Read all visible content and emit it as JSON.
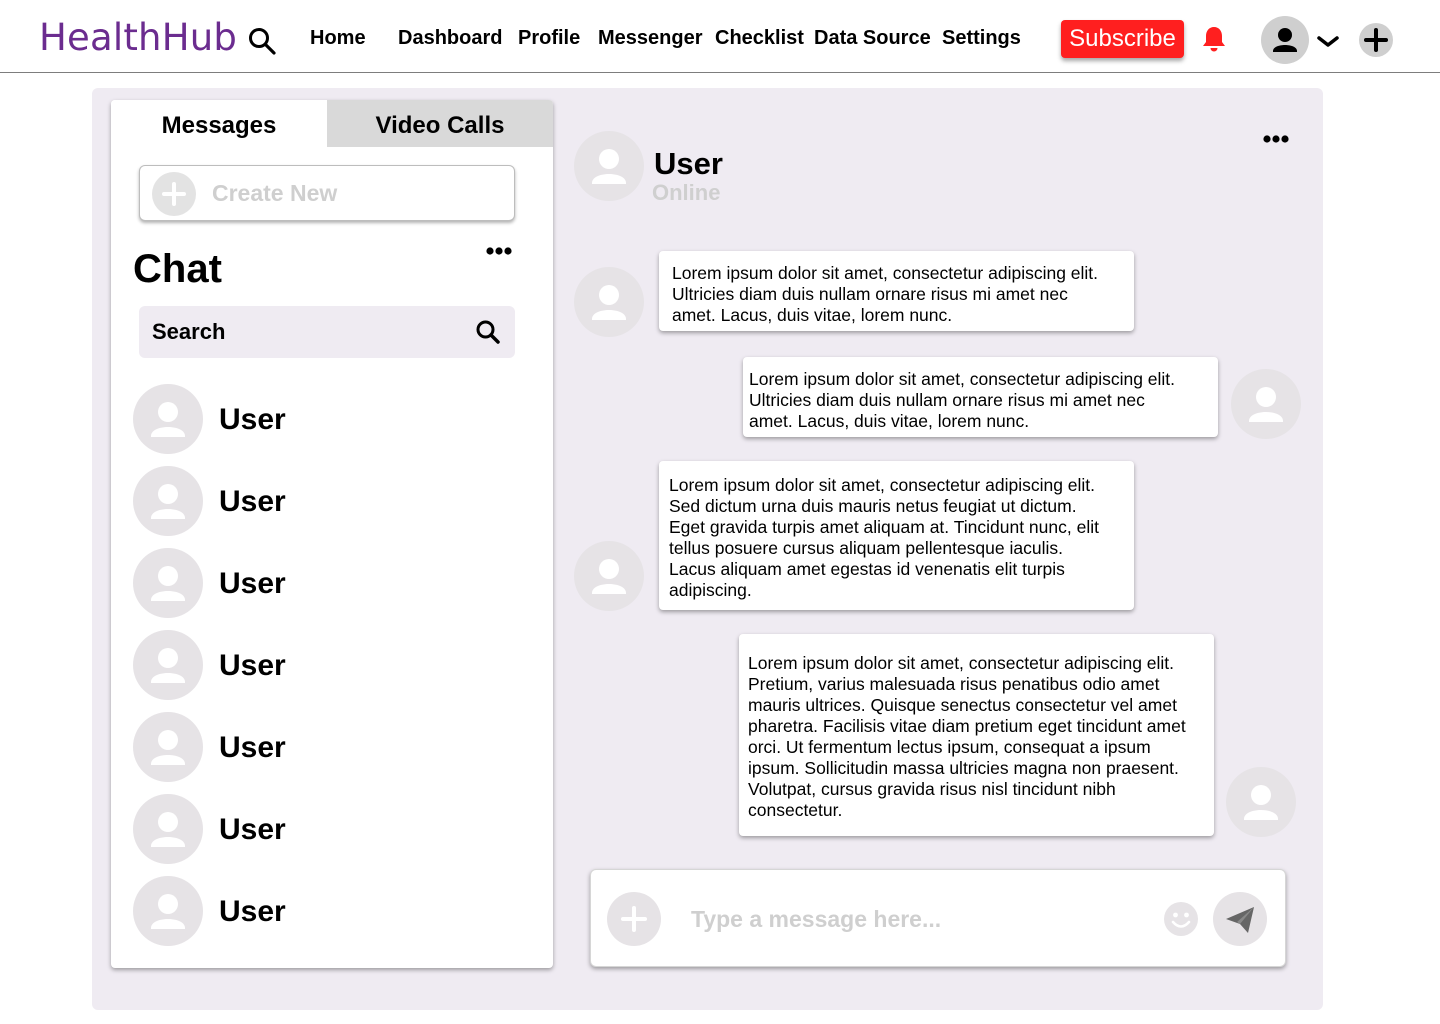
{
  "nav": {
    "logo": "HealthHub",
    "links": [
      "Home",
      "Dashboard",
      "Profile",
      "Messenger",
      "Checklist",
      "Data Source",
      "Settings"
    ],
    "subscribe": "Subscribe"
  },
  "sidebar": {
    "tabs": [
      "Messages",
      "Video Calls"
    ],
    "create_new": "Create New",
    "title": "Chat",
    "search": "Search",
    "users": [
      "User",
      "User",
      "User",
      "User",
      "User",
      "User",
      "User"
    ]
  },
  "chat": {
    "user": "User",
    "status": "Online",
    "messages": [
      {
        "side": "left",
        "lines": [
          "Lorem ipsum dolor sit amet, consectetur adipiscing elit.",
          "Ultricies diam duis nullam ornare risus mi amet nec",
          "amet. Lacus, duis vitae, lorem nunc."
        ]
      },
      {
        "side": "right",
        "lines": [
          "Lorem ipsum dolor sit amet, consectetur adipiscing elit.",
          "Ultricies diam duis nullam ornare risus mi amet nec",
          "amet. Lacus, duis vitae, lorem nunc."
        ]
      },
      {
        "side": "left",
        "lines": [
          "Lorem ipsum dolor sit amet, consectetur adipiscing elit.",
          "Sed dictum urna duis mauris netus feugiat ut dictum.",
          "Eget gravida turpis amet aliquam at. Tincidunt nunc, elit",
          "tellus posuere cursus aliquam pellentesque iaculis.",
          "Lacus aliquam amet egestas id venenatis elit turpis",
          "adipiscing."
        ]
      },
      {
        "side": "right",
        "lines": [
          "Lorem ipsum dolor sit amet, consectetur adipiscing elit.",
          "Pretium, varius malesuada risus penatibus odio amet",
          "mauris ultrices. Quisque senectus consectetur vel amet",
          "pharetra. Facilisis vitae diam pretium eget tincidunt amet",
          "orci. Ut fermentum lectus ipsum, consequat a ipsum",
          "ipsum. Sollicitudin massa ultricies magna non praesent.",
          "Volutpat, cursus gravida risus nisl tincidunt nibh",
          "consectetur."
        ]
      }
    ],
    "input_placeholder": "Type a message here..."
  },
  "colors": {
    "brand": "#6b2c8f",
    "subscribe": "#ff1f1f",
    "panel": "#efebf2",
    "placeholder": "#cfcfcf"
  }
}
